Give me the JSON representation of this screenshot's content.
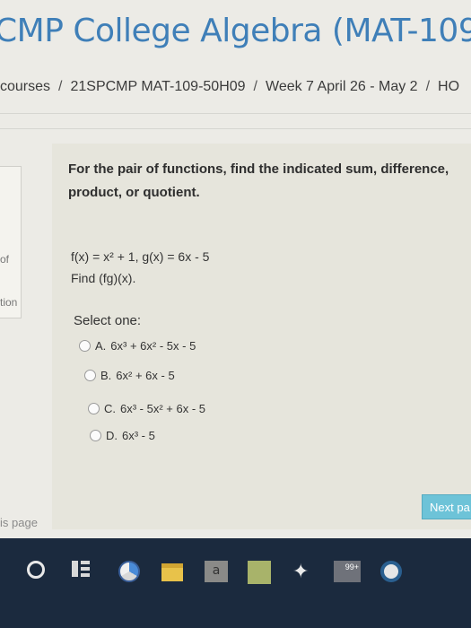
{
  "header": {
    "title": "CMP College Algebra (MAT-109"
  },
  "breadcrumb": [
    "courses",
    "21SPCMP MAT-109-50H09",
    "Week 7 April 26 - May 2",
    "HO"
  ],
  "sidebar": {
    "fragment_top": "of",
    "fragment_bottom": "tion"
  },
  "question": {
    "instruction": "For the pair of functions, find the indicated sum, difference, product, or quotient.",
    "functions": "f(x) = x² + 1, g(x) = 6x - 5",
    "task": "Find (fg)(x).",
    "select_label": "Select one:",
    "options": [
      {
        "letter": "A.",
        "text": "6x³ + 6x² - 5x - 5"
      },
      {
        "letter": "B.",
        "text": "6x² + 6x - 5"
      },
      {
        "letter": "C.",
        "text": "6x³ - 5x² + 6x - 5"
      },
      {
        "letter": "D.",
        "text": "6x³ - 5"
      }
    ]
  },
  "nav": {
    "next_label": "Next pa",
    "page_link": "is page"
  },
  "taskbar": {
    "amazon_label": "a",
    "mail_badge": "99+"
  }
}
